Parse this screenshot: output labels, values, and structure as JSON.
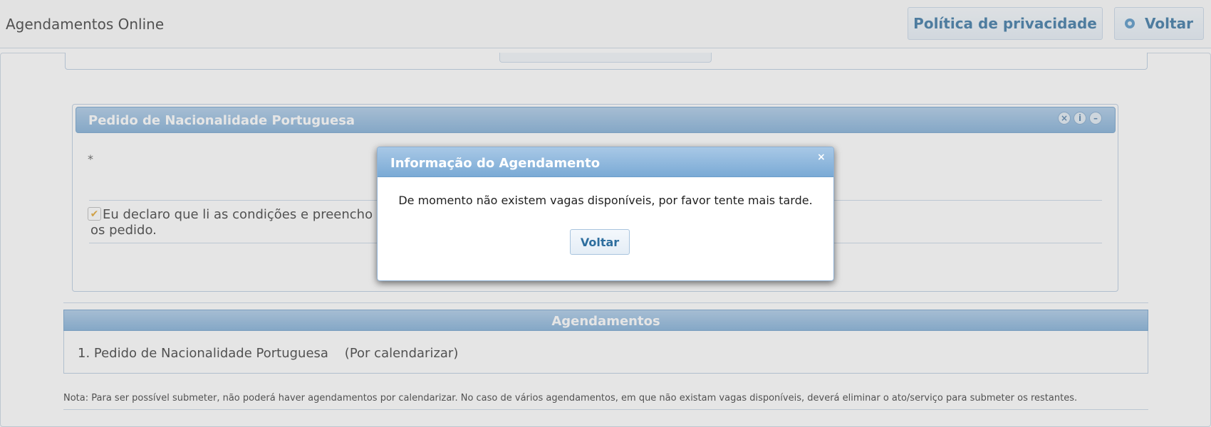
{
  "header": {
    "app_title": "Agendamentos Online",
    "privacy_label": "Política de privacidade",
    "back_label": "Voltar"
  },
  "panel": {
    "title": "Pedido de Nacionalidade Portuguesa",
    "required_marker": "*",
    "declaration_text": "Eu declaro que li as condições e preencho os pedido.",
    "declaration_checked": true
  },
  "agendamentos": {
    "title": "Agendamentos",
    "items": [
      {
        "text": "1. Pedido de Nacionalidade Portuguesa    (Por calendarizar)"
      }
    ]
  },
  "note": "Nota: Para ser possível submeter, não poderá haver agendamentos por calendarizar. No caso de vários agendamentos, em que não existam vagas disponíveis, deverá eliminar o ato/serviço para submeter os restantes.",
  "dialog": {
    "title": "Informação do Agendamento",
    "close_symbol": "×",
    "message": "De momento não existem vagas disponíveis, por favor tente mais tarde.",
    "button_label": "Voltar"
  },
  "colors": {
    "header_blue": "#7aaad5",
    "link_blue": "#2e6e9e",
    "checkbox_accent": "#e2a227"
  }
}
